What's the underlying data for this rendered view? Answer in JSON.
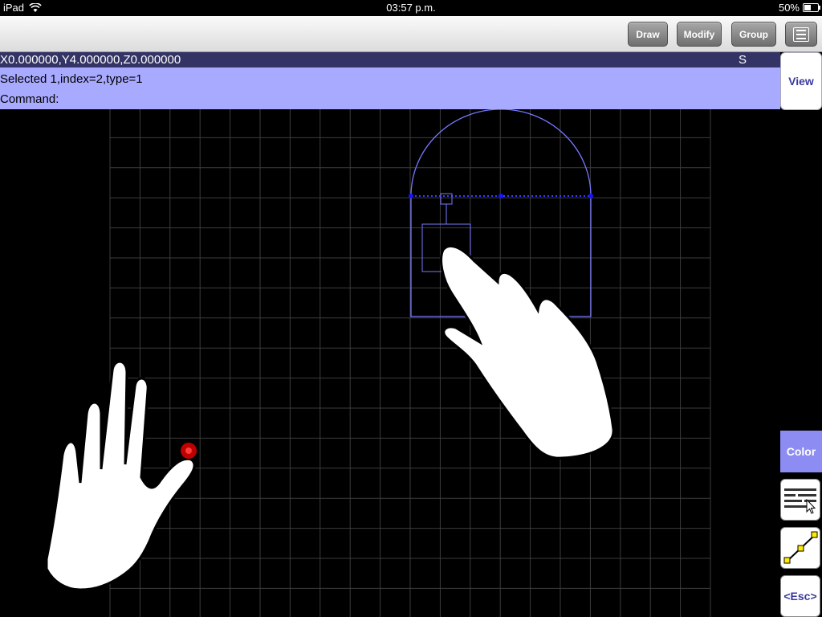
{
  "status_bar": {
    "device": "iPad",
    "time": "03:57 p.m.",
    "battery": "50%",
    "battery_level": 0.5
  },
  "toolbar": {
    "draw": "Draw",
    "modify": "Modify",
    "group": "Group",
    "menu_icon": "menu-list-icon"
  },
  "coord_bar": {
    "coords": "X0.000000,Y4.000000,Z0.000000",
    "snap": "S"
  },
  "info": {
    "selected": "Selected 1,index=2,type=1",
    "command": "Command:"
  },
  "view_button": "View",
  "side_buttons": {
    "color": "Color",
    "layers_icon": "layers-list-icon",
    "snap_icon": "line-endpoints-icon",
    "esc": "<Esc>"
  },
  "colors": {
    "selection": "#7777ff",
    "grid": "#3c3c3c",
    "info_bg": "#a8aaff",
    "coord_bg": "#333366",
    "touch_point": "#e00000"
  }
}
